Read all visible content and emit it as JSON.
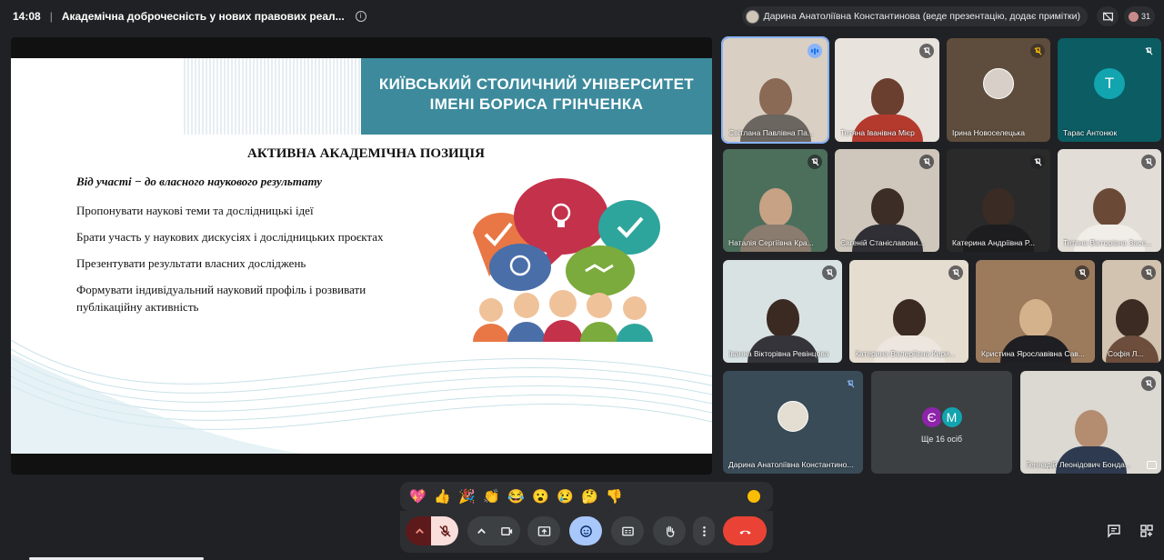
{
  "topbar": {
    "time": "14:08",
    "meeting_title": "Академічна доброчесність у нових правових реал...",
    "presenter_label": "Дарина Анатоліївна Константинова (веде презентацію, додає примітки)",
    "participant_count": "31"
  },
  "slide": {
    "university_line1": "КИЇВСЬКИЙ СТОЛИЧНИЙ УНІВЕРСИТЕТ",
    "university_line2": "ІМЕНІ БОРИСА ГРІНЧЕНКА",
    "heading": "АКТИВНА АКАДЕМІЧНА ПОЗИЦІЯ",
    "subheading": "Від участі − до власного наукового результату",
    "bullets": [
      "Пропонувати наукові теми та дослідницькі ідеї",
      "Брати участь у наукових дискусіях і дослідницьких проєктах",
      "Презентувати результати власних досліджень",
      "Формувати індивідуальний науковий профіль і розвивати публікаційну активність"
    ]
  },
  "participants": [
    {
      "name": "Світлана Павлівна Па...",
      "state": "speaking"
    },
    {
      "name": "Тетяна Іванівна Мієр",
      "state": "muted"
    },
    {
      "name": "Ірина Новоселецька",
      "state": "muted"
    },
    {
      "name": "Тарас Антонюк",
      "state": "muted",
      "initial": "Т"
    },
    {
      "name": "Наталія Сергіївна Кра...",
      "state": "muted"
    },
    {
      "name": "Євгеній Станіславови...",
      "state": "muted"
    },
    {
      "name": "Катерина Андріївна Р...",
      "state": "muted"
    },
    {
      "name": "Тетяна Вікторівна Засє...",
      "state": "muted"
    },
    {
      "name": "Іванна Вікторівна Ревінцова",
      "state": "muted"
    },
    {
      "name": "Катерина Валеріївна Кири...",
      "state": "muted"
    },
    {
      "name": "Кристина Ярославівна Сав...",
      "state": "muted"
    },
    {
      "name": "Софія Л...",
      "state": "muted"
    },
    {
      "name": "Дарина Анатоліївна Константино...",
      "state": "muted"
    },
    {
      "name": "Геннадій Леонідович Бонда...",
      "state": "muted"
    }
  ],
  "others_tile": {
    "initial_1": "Є",
    "initial_2": "М",
    "label": "Ще 16 осіб"
  },
  "reactions": [
    "💖",
    "👍",
    "🎉",
    "👏",
    "😂",
    "😮",
    "😢",
    "🤔",
    "👎"
  ],
  "colors": {
    "background": "#202124",
    "panel": "#2d2e31",
    "slide_banner": "#3c8a9c",
    "end_call": "#ea4335",
    "mic_off": "#f9dedc",
    "reaction_active": "#a8c7fa"
  },
  "icons": {
    "info": "info-icon",
    "present_block": "present-blocked-icon",
    "mic_off": "mic-off-icon",
    "camera": "camera-icon",
    "present": "present-icon",
    "emoji": "emoji-icon",
    "captions": "captions-icon",
    "hand": "raise-hand-icon",
    "more": "more-vert-icon",
    "end_call": "call-end-icon",
    "chat": "chat-icon",
    "activities": "activities-icon"
  }
}
